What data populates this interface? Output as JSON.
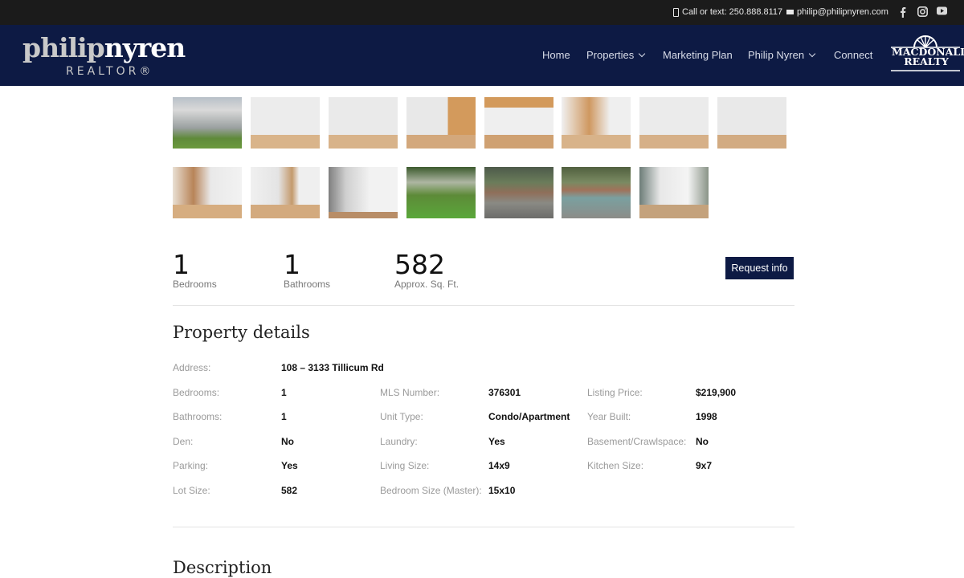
{
  "topbar": {
    "phone": "Call or text: 250.888.8117",
    "email": "philip@philipnyren.com"
  },
  "logo": {
    "part1": "philip",
    "part2": "nyren",
    "sub": "REALTOR®"
  },
  "nav": {
    "items": [
      {
        "label": "Home"
      },
      {
        "label": "Properties"
      },
      {
        "label": "Marketing Plan"
      },
      {
        "label": "Philip Nyren"
      },
      {
        "label": "Connect"
      }
    ]
  },
  "brand": {
    "line1": "MACDONALD",
    "line2": "REALTY"
  },
  "stats": {
    "bedrooms": {
      "value": "1",
      "label": "Bedrooms"
    },
    "bathrooms": {
      "value": "1",
      "label": "Bathrooms"
    },
    "sqft": {
      "value": "582",
      "label": "Approx. Sq. Ft."
    },
    "request_label": "Request info"
  },
  "details": {
    "title": "Property details",
    "address": {
      "label": "Address:",
      "value": "108 – 3133 Tillicum Rd"
    },
    "col1": [
      {
        "label": "Bedrooms:",
        "value": "1"
      },
      {
        "label": "Bathrooms:",
        "value": "1"
      },
      {
        "label": "Den:",
        "value": "No"
      },
      {
        "label": "Parking:",
        "value": "Yes"
      },
      {
        "label": "Lot Size:",
        "value": "582"
      }
    ],
    "col2": [
      {
        "label": "MLS Number:",
        "value": "376301"
      },
      {
        "label": "Unit Type:",
        "value": "Condo/Apartment"
      },
      {
        "label": "Laundry:",
        "value": "Yes"
      },
      {
        "label": "Living Size:",
        "value": "14x9"
      },
      {
        "label": "Bedroom Size (Master):",
        "value": "15x10"
      }
    ],
    "col3": [
      {
        "label": "Listing Price:",
        "value": "$219,900"
      },
      {
        "label": "Year Built:",
        "value": "1998"
      },
      {
        "label": "Basement/Crawlspace:",
        "value": "No"
      },
      {
        "label": "Kitchen Size:",
        "value": "9x7"
      }
    ]
  },
  "description": {
    "title": "Description"
  },
  "colors": {
    "topbar": "#1b1b1b",
    "header": "#0d1a44",
    "button": "#0d1a44"
  }
}
